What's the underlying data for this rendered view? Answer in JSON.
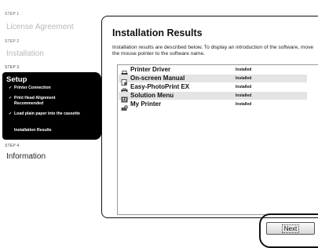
{
  "sidebar": {
    "step1": {
      "label": "STEP 1",
      "title": "License Agreement"
    },
    "step2": {
      "label": "STEP 2",
      "title": "Installation"
    },
    "step3": {
      "label": "STEP 3",
      "title": "Setup",
      "items": [
        {
          "check": "✓",
          "text": "Printer Connection"
        },
        {
          "check": "✓",
          "text": "Print Head Alignment Recommended"
        },
        {
          "check": "✓",
          "text": "Load plain paper into the cassette"
        },
        {
          "check": "",
          "text": "Installation Results"
        }
      ]
    },
    "step4": {
      "label": "STEP 4",
      "title": "Information"
    }
  },
  "main": {
    "title": "Installation Results",
    "description": "Installation results are described below. To display an introduction of the software, move the mouse pointer to the software name.",
    "results": [
      {
        "name": "Printer Driver",
        "status": "Installed",
        "icon": "printer-icon"
      },
      {
        "name": "On-screen Manual",
        "status": "Installed",
        "icon": "manual-icon"
      },
      {
        "name": "Easy-PhotoPrint EX",
        "status": "Installed",
        "icon": "photo-print-icon"
      },
      {
        "name": "Solution Menu",
        "status": "Installed",
        "icon": "solution-menu-icon"
      },
      {
        "name": "My Printer",
        "status": "Installed",
        "icon": "my-printer-icon"
      }
    ]
  },
  "footer": {
    "next_label": "Next"
  }
}
